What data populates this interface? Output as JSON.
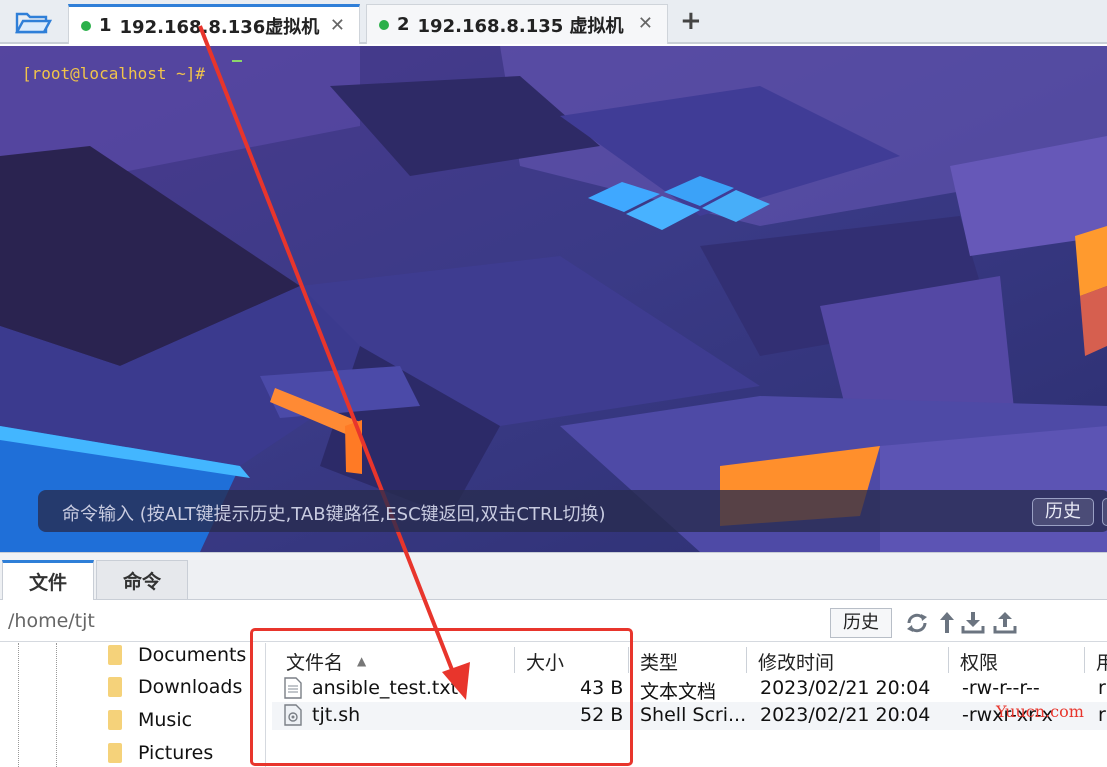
{
  "tabs": [
    {
      "num": "1",
      "label": "192.168.8.136虚拟机",
      "close": "✕",
      "active": true
    },
    {
      "num": "2",
      "label": "192.168.8.135 虚拟机",
      "close": "✕",
      "active": false
    }
  ],
  "add_tab": "+",
  "terminal": {
    "prompt": "[root@localhost ~]#",
    "command_hint": "命令输入 (按ALT键提示历史,TAB键路径,ESC键返回,双击CTRL切换)",
    "history_button": "历史"
  },
  "panel_tabs": [
    "文件",
    "命令"
  ],
  "path": "/home/tjt",
  "path_history_button": "历史",
  "toolbar_icons": [
    "refresh-icon",
    "up-directory-icon",
    "download-icon",
    "upload-icon"
  ],
  "tree": [
    "Documents",
    "Downloads",
    "Music",
    "Pictures"
  ],
  "files": {
    "columns": [
      "文件名",
      "大小",
      "类型",
      "修改时间",
      "权限",
      "用"
    ],
    "rows": [
      {
        "name": "ansible_test.txt",
        "size": "43 B",
        "type": "文本文档",
        "mtime": "2023/02/21 20:04",
        "perm": "-rw-r--r--",
        "owner": "r"
      },
      {
        "name": "tjt.sh",
        "size": "52 B",
        "type": "Shell Scri...",
        "mtime": "2023/02/21 20:04",
        "perm": "-rwxr-xr-x",
        "owner": "r"
      }
    ]
  },
  "watermark": "Yuucn.com",
  "colors": {
    "accent": "#2f7fd8",
    "annotation": "#e8352c",
    "status_dot": "#2bb04a",
    "prompt": "#f1c44a"
  }
}
